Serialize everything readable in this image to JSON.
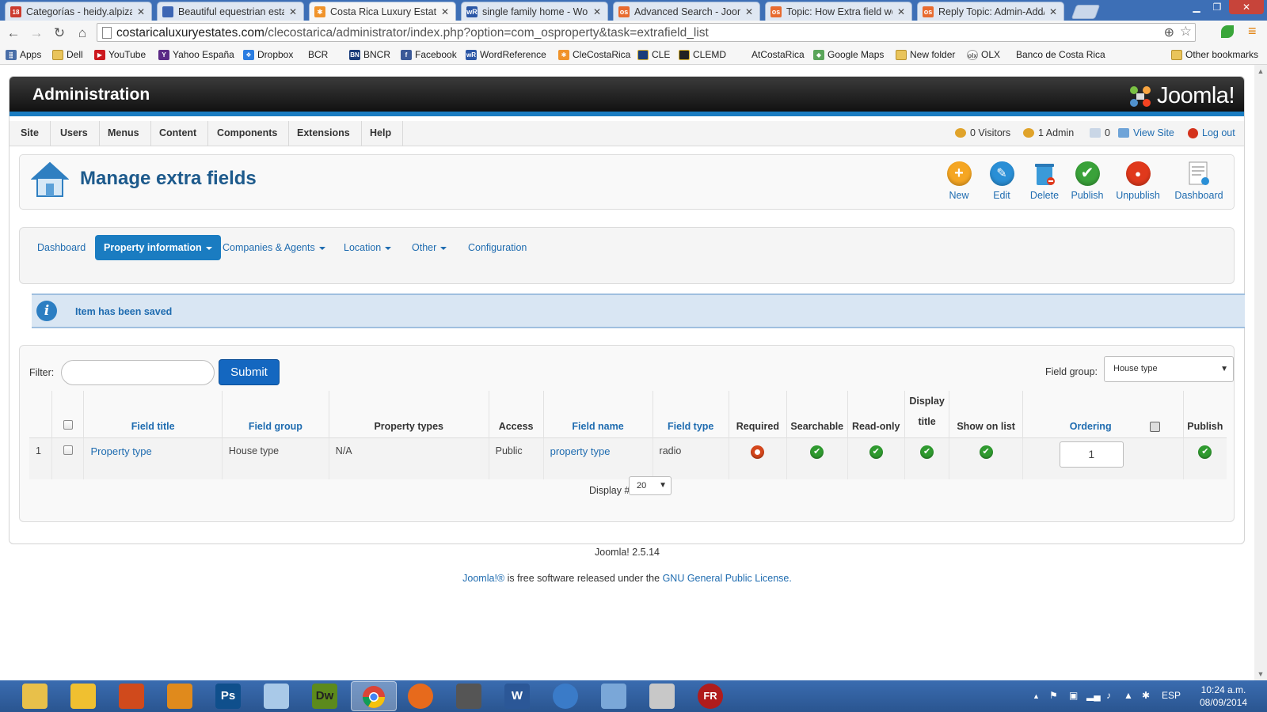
{
  "browser": {
    "tabs": [
      {
        "title": "Categorías - heidy.alpizar",
        "favicon": "gmail-icon",
        "color": "#cc3b2e"
      },
      {
        "title": "Beautiful equestrian estat",
        "favicon": "site-icon",
        "color": "#3d66b4"
      },
      {
        "title": "Costa Rica Luxury Estates",
        "favicon": "joomla-icon",
        "color": "#f0932a"
      },
      {
        "title": "single family home - Wor",
        "favicon": "wordreference-icon",
        "color": "#2b57a6"
      },
      {
        "title": "Advanced Search - Joom",
        "favicon": "os-icon",
        "color": "#e86b2f"
      },
      {
        "title": "Topic: How Extra field wo",
        "favicon": "os-icon",
        "color": "#e86b2f"
      },
      {
        "title": "Reply Topic: Admin-Add/",
        "favicon": "os-icon",
        "color": "#e86b2f"
      }
    ],
    "tab_badge": "18",
    "url_host": "costaricaluxuryestates.com",
    "url_path": "/clecostarica/administrator/index.php?option=com_osproperty&task=extrafield_list",
    "bookmarks": [
      {
        "label": "Apps",
        "icon": "apps-icon"
      },
      {
        "label": "Dell",
        "icon": "folder-icon"
      },
      {
        "label": "YouTube",
        "icon": "youtube-icon"
      },
      {
        "label": "Yahoo España",
        "icon": "yahoo-icon"
      },
      {
        "label": "Dropbox",
        "icon": "dropbox-icon"
      },
      {
        "label": "BCR",
        "icon": "page-icon"
      },
      {
        "label": "BNCR",
        "icon": "bn-icon"
      },
      {
        "label": "Facebook",
        "icon": "facebook-icon"
      },
      {
        "label": "WordReference",
        "icon": "wordreference-icon"
      },
      {
        "label": "CleCostaRica",
        "icon": "joomla-icon"
      },
      {
        "label": "CLE",
        "icon": "cle-icon"
      },
      {
        "label": "CLEMD",
        "icon": "cle-icon"
      },
      {
        "label": "AtCostaRica",
        "icon": "blank-icon"
      },
      {
        "label": "Google Maps",
        "icon": "maps-icon"
      },
      {
        "label": "New folder",
        "icon": "folder-icon"
      },
      {
        "label": "OLX",
        "icon": "olx-icon"
      },
      {
        "label": "Banco de Costa Rica",
        "icon": "page-icon"
      }
    ],
    "other_bookmarks": "Other bookmarks"
  },
  "admin": {
    "header_title": "Administration",
    "logo_text": "Joomla!",
    "menu": [
      "Site",
      "Users",
      "Menus",
      "Content",
      "Components",
      "Extensions",
      "Help"
    ],
    "status": {
      "visitors": "0 Visitors",
      "admins": "1 Admin",
      "messages": "0",
      "view_site": "View Site",
      "logout": "Log out"
    },
    "page_title": "Manage extra fields",
    "toolbar": [
      {
        "label": "New",
        "icon": "new-icon",
        "color": "#f5a623",
        "glyph": "+"
      },
      {
        "label": "Edit",
        "icon": "edit-icon",
        "color": "#2a8fd6",
        "glyph": "✎"
      },
      {
        "label": "Delete",
        "icon": "delete-icon",
        "color": "#3a9ad9",
        "glyph": ""
      },
      {
        "label": "Publish",
        "icon": "publish-icon",
        "color": "#3aa23a",
        "glyph": "✔"
      },
      {
        "label": "Unpublish",
        "icon": "unpublish-icon",
        "color": "#e0391c",
        "glyph": "●"
      },
      {
        "label": "Dashboard",
        "icon": "dashboard-icon",
        "color": "#e6e6e6",
        "glyph": ""
      }
    ],
    "subnav": [
      "Dashboard",
      "Property information",
      "Companies & Agents",
      "Location",
      "Other",
      "Configuration"
    ],
    "message": "Item has been saved",
    "filter_label": "Filter:",
    "filter_value": "",
    "submit_label": "Submit",
    "field_group_label": "Field group:",
    "field_group_value": "House type",
    "columns": {
      "title": "Field title",
      "group": "Field group",
      "types": "Property types",
      "access": "Access",
      "name": "Field name",
      "type": "Field type",
      "required": "Required",
      "searchable": "Searchable",
      "readonly": "Read-only",
      "display_title_1": "Display",
      "display_title_2": "title",
      "show_on_list": "Show on list",
      "ordering": "Ordering",
      "publish": "Publish"
    },
    "rows": [
      {
        "num": "1",
        "title": "Property type",
        "group": "House type",
        "types": "N/A",
        "access": "Public",
        "name": "property type",
        "type": "radio",
        "required": "no",
        "searchable": "yes",
        "readonly": "yes",
        "display_title": "yes",
        "show_on_list": "yes",
        "ordering": "1",
        "publish": "yes"
      }
    ],
    "display_label": "Display #",
    "display_value": "20",
    "footer_version": "Joomla! 2.5.14",
    "footer_license_pre": " is free software released under the ",
    "footer_license_link1": "Joomla!®",
    "footer_license_link2": "GNU General Public License."
  },
  "taskbar": {
    "language": "ESP",
    "time": "10:24 a.m.",
    "date": "08/09/2014",
    "apps": [
      {
        "name": "explorer-icon",
        "color": "#e8c04a",
        "glyph": ""
      },
      {
        "name": "outlook-icon",
        "color": "#f0c030",
        "glyph": ""
      },
      {
        "name": "office-icon",
        "color": "#d04a1c",
        "glyph": ""
      },
      {
        "name": "illustrator-icon",
        "color": "#e08a1c",
        "glyph": ""
      },
      {
        "name": "photoshop-icon",
        "color": "#0f4f8c",
        "glyph": "Ps"
      },
      {
        "name": "notepad-icon",
        "color": "#a9c9e8",
        "glyph": ""
      },
      {
        "name": "dreamweaver-icon",
        "color": "#5c8a1c",
        "glyph": "Dw"
      },
      {
        "name": "chrome-icon",
        "color": "#db4437",
        "glyph": ""
      },
      {
        "name": "firefox-icon",
        "color": "#e76a1c",
        "glyph": ""
      },
      {
        "name": "scanner-icon",
        "color": "#555555",
        "glyph": ""
      },
      {
        "name": "word-icon",
        "color": "#2b5797",
        "glyph": "W"
      },
      {
        "name": "thunderbird-icon",
        "color": "#3a7bc8",
        "glyph": ""
      },
      {
        "name": "ftp-icon",
        "color": "#7aa7d8",
        "glyph": ""
      },
      {
        "name": "calculator-icon",
        "color": "#c8c8c8",
        "glyph": ""
      },
      {
        "name": "filezilla-icon",
        "color": "#b01c1c",
        "glyph": "FR"
      }
    ]
  }
}
